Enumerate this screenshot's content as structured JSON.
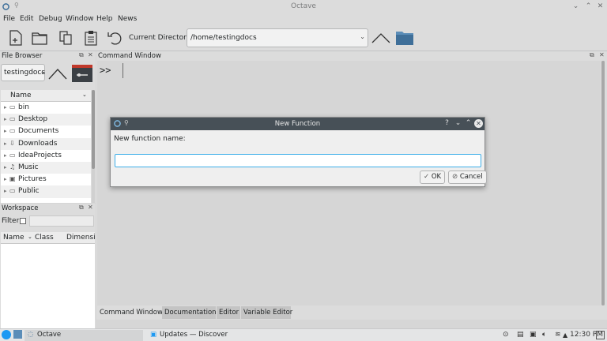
{
  "window": {
    "title": "Octave"
  },
  "menu": [
    "File",
    "Edit",
    "Debug",
    "Window",
    "Help",
    "News"
  ],
  "toolbar": {
    "current_dir_label": "Current Directory:",
    "current_dir": "/home/testingdocs"
  },
  "file_browser": {
    "title": "File Browser",
    "path": "testingdocs",
    "column": "Name",
    "items": [
      {
        "label": "bin",
        "icon": "folder-icon"
      },
      {
        "label": "Desktop",
        "icon": "desktop-icon"
      },
      {
        "label": "Documents",
        "icon": "folder-icon"
      },
      {
        "label": "Downloads",
        "icon": "download-icon"
      },
      {
        "label": "IdeaProjects",
        "icon": "folder-icon"
      },
      {
        "label": "Music",
        "icon": "music-icon"
      },
      {
        "label": "Pictures",
        "icon": "image-icon"
      },
      {
        "label": "Public",
        "icon": "folder-icon"
      }
    ]
  },
  "workspace": {
    "title": "Workspace",
    "filter_label": "Filter",
    "columns": [
      "Name",
      "Class",
      "Dimensic"
    ]
  },
  "command_window": {
    "title": "Command Window",
    "prompt": ">>",
    "tabs": [
      "Command Window",
      "Documentation",
      "Editor",
      "Variable Editor"
    ]
  },
  "dialog": {
    "title": "New Function",
    "label": "New function name:",
    "input_value": "",
    "ok": "OK",
    "cancel": "Cancel"
  },
  "taskbar": {
    "tasks": [
      "Octave",
      "Updates — Discover"
    ],
    "time": "12:30 PM"
  },
  "colors": {
    "accent": "#3daee9",
    "dialog_title": "#475057",
    "folder": "#5b8db8"
  }
}
